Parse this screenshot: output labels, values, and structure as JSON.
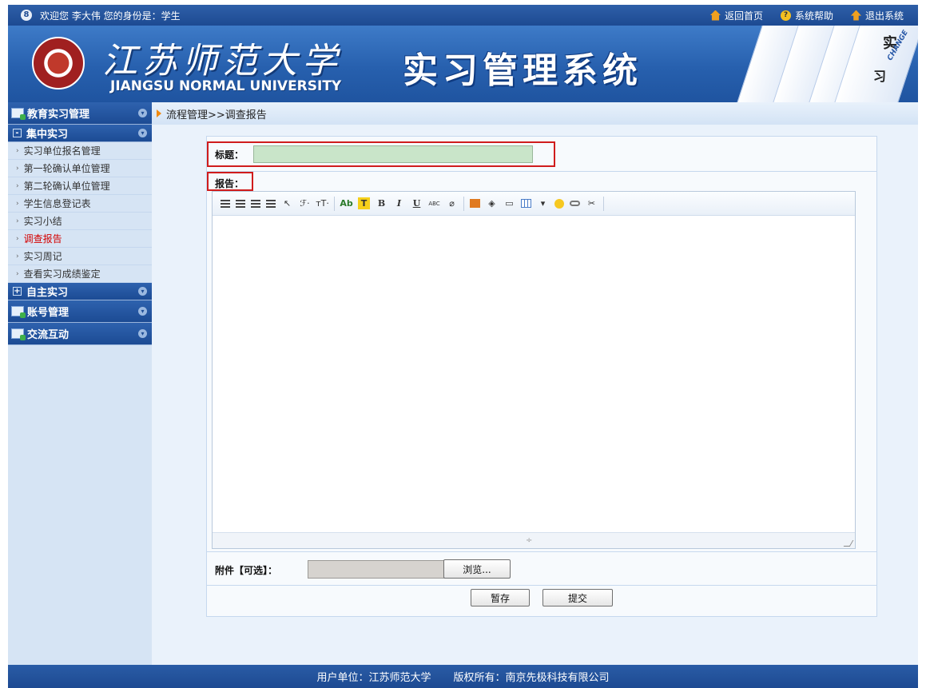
{
  "topbar": {
    "welcome": "欢迎您 李大伟 您的身份是：学生",
    "home": "返回首页",
    "help": "系统帮助",
    "exit": "退出系统"
  },
  "banner": {
    "university_cn": "江苏师范大学",
    "university_en": "JIANGSU NORMAL UNIVERSITY",
    "system_title": "实习管理系统",
    "card_char_1": "实",
    "card_char_2": "习",
    "card_change": "CHANGE"
  },
  "sidebar": {
    "section_education": "教育实习管理",
    "group_centralized": "集中实习",
    "items": [
      {
        "label": "实习单位报名管理",
        "active": false
      },
      {
        "label": "第一轮确认单位管理",
        "active": false
      },
      {
        "label": "第二轮确认单位管理",
        "active": false
      },
      {
        "label": "学生信息登记表",
        "active": false
      },
      {
        "label": "实习小结",
        "active": false
      },
      {
        "label": "调查报告",
        "active": true
      },
      {
        "label": "实习周记",
        "active": false
      },
      {
        "label": "查看实习成绩鉴定",
        "active": false
      }
    ],
    "group_independent": "自主实习",
    "section_account": "账号管理",
    "section_communication": "交流互动"
  },
  "breadcrumb": "流程管理>>调查报告",
  "form": {
    "title_label": "标题：",
    "title_value": "",
    "report_label": "报告：",
    "attachment_label": "附件【可选】：",
    "browse_label": "浏览...",
    "save_label": "暂存",
    "submit_label": "提交"
  },
  "editor_toolbar": {
    "font": "ℱ·",
    "size": "тT·",
    "ab": "Ab",
    "highlight": "T",
    "bold": "B",
    "italic": "I",
    "underline": "U",
    "strike": "ABC"
  },
  "footer": {
    "unit": "用户单位：江苏师范大学",
    "copyright": "版权所有：南京先极科技有限公司"
  },
  "colors": {
    "primary_blue": "#1d4a92",
    "highlight_red": "#d01c1c",
    "active_item": "#d40000",
    "title_input_bg": "#c9e5c9"
  }
}
